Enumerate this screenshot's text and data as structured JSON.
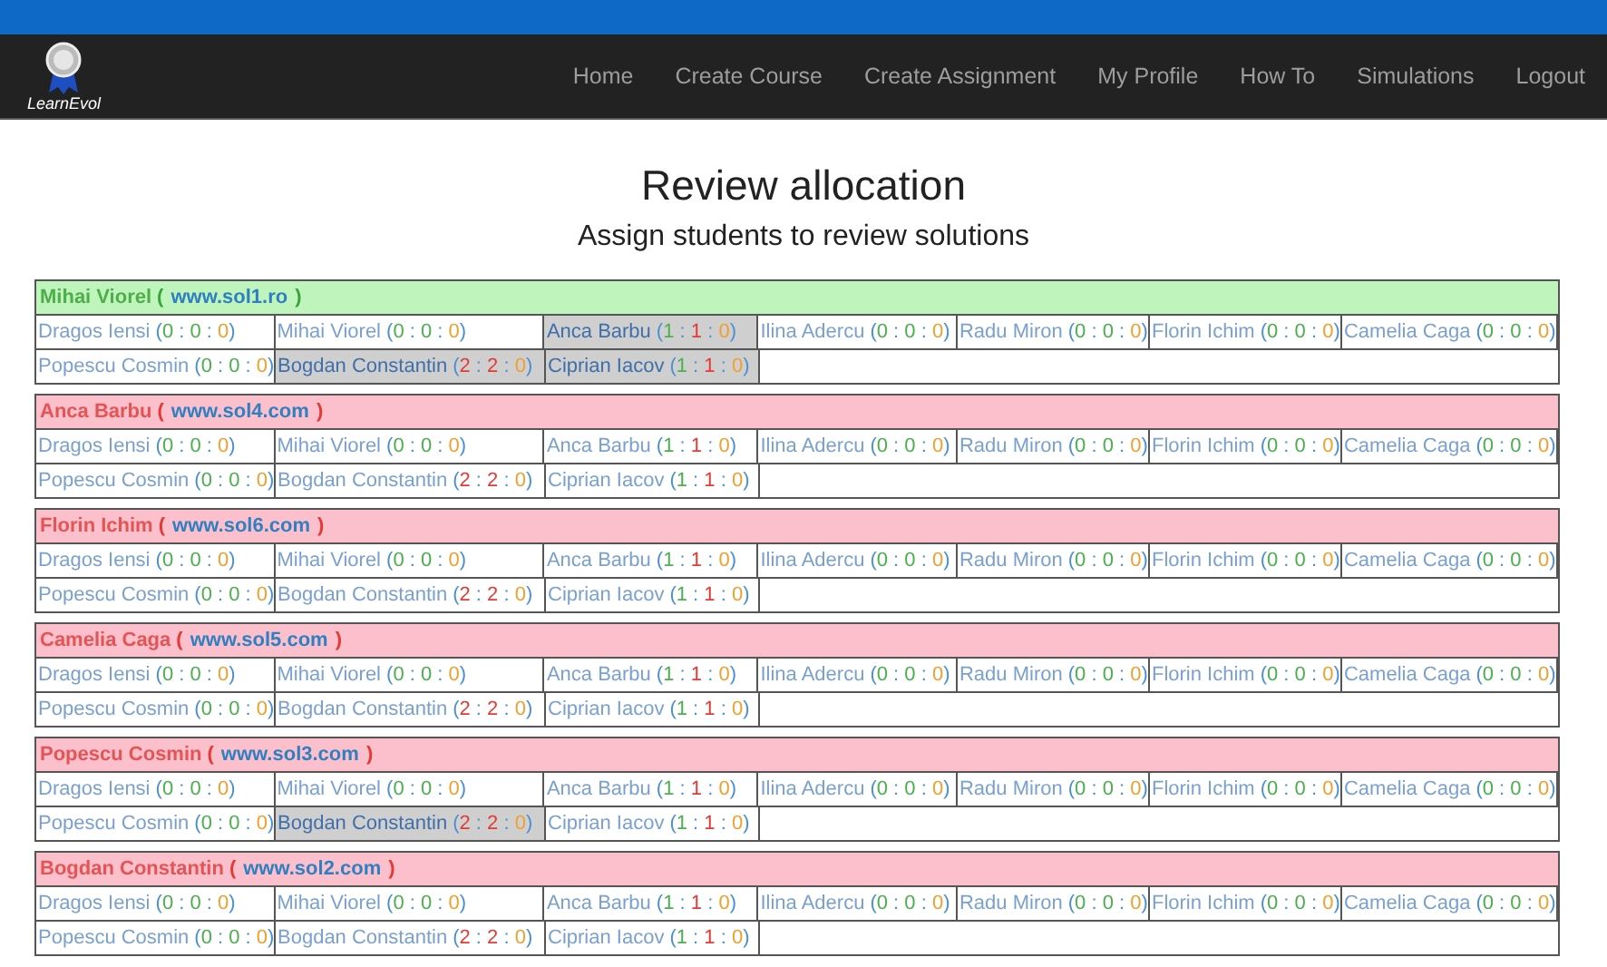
{
  "navbar": {
    "logo_text": "LearnEvol",
    "links": [
      {
        "label": "Home"
      },
      {
        "label": "Create Course"
      },
      {
        "label": "Create Assignment"
      },
      {
        "label": "My Profile"
      },
      {
        "label": "How To"
      },
      {
        "label": "Simulations"
      },
      {
        "label": "Logout"
      }
    ]
  },
  "title": "Review allocation",
  "subtitle": "Assign students to review solutions",
  "submissions": [
    {
      "author": "Mihai Viorel",
      "open": "(",
      "url": "www.sol1.ro",
      "close": ")",
      "kind": "complete",
      "cells": [
        {
          "name": "Dragos Iensi",
          "tally": "(0 : 0 : 0)",
          "counts": [
            {
              "color": "#4caf50"
            },
            {
              "color": "#4caf50"
            },
            {
              "color": "#f0a030"
            }
          ],
          "selected": false
        },
        {
          "name": "Mihai Viorel",
          "tally": "(0 : 0 : 0)",
          "counts": [
            {
              "color": "#4caf50"
            },
            {
              "color": "#4caf50"
            },
            {
              "color": "#f0a030"
            }
          ],
          "selected": false
        },
        {
          "name": "Anca Barbu",
          "tally": "(1 : 1 : 0)",
          "counts": [
            {
              "color": "#4caf50"
            },
            {
              "color": "#e53935"
            },
            {
              "color": "#f0a030"
            }
          ],
          "selected": true
        },
        {
          "name": "Ilina Adercu",
          "tally": "(0 : 0 : 0)",
          "counts": [
            {
              "color": "#4caf50"
            },
            {
              "color": "#4caf50"
            },
            {
              "color": "#f0a030"
            }
          ],
          "selected": false
        },
        {
          "name": "Radu Miron",
          "tally": "(0 : 0 : 0)",
          "counts": [
            {
              "color": "#4caf50"
            },
            {
              "color": "#4caf50"
            },
            {
              "color": "#f0a030"
            }
          ],
          "selected": false
        },
        {
          "name": "Florin Ichim",
          "tally": "(0 : 0 : 0)",
          "counts": [
            {
              "color": "#4caf50"
            },
            {
              "color": "#4caf50"
            },
            {
              "color": "#f0a030"
            }
          ],
          "selected": false
        },
        {
          "name": "Camelia Caga",
          "tally": "(0 : 0 : 0)",
          "counts": [
            {
              "color": "#4caf50"
            },
            {
              "color": "#4caf50"
            },
            {
              "color": "#f0a030"
            }
          ],
          "selected": false
        },
        {
          "name": "Popescu Cosmin",
          "tally": "(0 : 0 : 0)",
          "counts": [
            {
              "color": "#4caf50"
            },
            {
              "color": "#4caf50"
            },
            {
              "color": "#f0a030"
            }
          ],
          "selected": false
        },
        {
          "name": "Bogdan Constantin",
          "tally": "(2 : 2 : 0)",
          "counts": [
            {
              "color": "#e53935"
            },
            {
              "color": "#e53935"
            },
            {
              "color": "#f0a030"
            }
          ],
          "selected": true
        },
        {
          "name": "Ciprian Iacov",
          "tally": "(1 : 1 : 0)",
          "counts": [
            {
              "color": "#4caf50"
            },
            {
              "color": "#e53935"
            },
            {
              "color": "#f0a030"
            }
          ],
          "selected": true
        }
      ]
    },
    {
      "author": "Anca Barbu",
      "open": "(",
      "url": "www.sol4.com",
      "close": ")",
      "kind": "pending",
      "cells": [
        {
          "name": "Dragos Iensi",
          "tally": "(0 : 0 : 0)",
          "counts": [
            {
              "color": "#4caf50"
            },
            {
              "color": "#4caf50"
            },
            {
              "color": "#f0a030"
            }
          ],
          "selected": false
        },
        {
          "name": "Mihai Viorel",
          "tally": "(0 : 0 : 0)",
          "counts": [
            {
              "color": "#4caf50"
            },
            {
              "color": "#4caf50"
            },
            {
              "color": "#f0a030"
            }
          ],
          "selected": false
        },
        {
          "name": "Anca Barbu",
          "tally": "(1 : 1 : 0)",
          "counts": [
            {
              "color": "#4caf50"
            },
            {
              "color": "#e53935"
            },
            {
              "color": "#f0a030"
            }
          ],
          "selected": false
        },
        {
          "name": "Ilina Adercu",
          "tally": "(0 : 0 : 0)",
          "counts": [
            {
              "color": "#4caf50"
            },
            {
              "color": "#4caf50"
            },
            {
              "color": "#f0a030"
            }
          ],
          "selected": false
        },
        {
          "name": "Radu Miron",
          "tally": "(0 : 0 : 0)",
          "counts": [
            {
              "color": "#4caf50"
            },
            {
              "color": "#4caf50"
            },
            {
              "color": "#f0a030"
            }
          ],
          "selected": false
        },
        {
          "name": "Florin Ichim",
          "tally": "(0 : 0 : 0)",
          "counts": [
            {
              "color": "#4caf50"
            },
            {
              "color": "#4caf50"
            },
            {
              "color": "#f0a030"
            }
          ],
          "selected": false
        },
        {
          "name": "Camelia Caga",
          "tally": "(0 : 0 : 0)",
          "counts": [
            {
              "color": "#4caf50"
            },
            {
              "color": "#4caf50"
            },
            {
              "color": "#f0a030"
            }
          ],
          "selected": false
        },
        {
          "name": "Popescu Cosmin",
          "tally": "(0 : 0 : 0)",
          "counts": [
            {
              "color": "#4caf50"
            },
            {
              "color": "#4caf50"
            },
            {
              "color": "#f0a030"
            }
          ],
          "selected": false
        },
        {
          "name": "Bogdan Constantin",
          "tally": "(2 : 2 : 0)",
          "counts": [
            {
              "color": "#e53935"
            },
            {
              "color": "#e53935"
            },
            {
              "color": "#f0a030"
            }
          ],
          "selected": false
        },
        {
          "name": "Ciprian Iacov",
          "tally": "(1 : 1 : 0)",
          "counts": [
            {
              "color": "#4caf50"
            },
            {
              "color": "#e53935"
            },
            {
              "color": "#f0a030"
            }
          ],
          "selected": false
        }
      ]
    },
    {
      "author": "Florin Ichim",
      "open": "(",
      "url": "www.sol6.com",
      "close": ")",
      "kind": "pending",
      "cells": [
        {
          "name": "Dragos Iensi",
          "tally": "(0 : 0 : 0)",
          "counts": [
            {
              "color": "#4caf50"
            },
            {
              "color": "#4caf50"
            },
            {
              "color": "#f0a030"
            }
          ],
          "selected": false
        },
        {
          "name": "Mihai Viorel",
          "tally": "(0 : 0 : 0)",
          "counts": [
            {
              "color": "#4caf50"
            },
            {
              "color": "#4caf50"
            },
            {
              "color": "#f0a030"
            }
          ],
          "selected": false
        },
        {
          "name": "Anca Barbu",
          "tally": "(1 : 1 : 0)",
          "counts": [
            {
              "color": "#4caf50"
            },
            {
              "color": "#e53935"
            },
            {
              "color": "#f0a030"
            }
          ],
          "selected": false
        },
        {
          "name": "Ilina Adercu",
          "tally": "(0 : 0 : 0)",
          "counts": [
            {
              "color": "#4caf50"
            },
            {
              "color": "#4caf50"
            },
            {
              "color": "#f0a030"
            }
          ],
          "selected": false
        },
        {
          "name": "Radu Miron",
          "tally": "(0 : 0 : 0)",
          "counts": [
            {
              "color": "#4caf50"
            },
            {
              "color": "#4caf50"
            },
            {
              "color": "#f0a030"
            }
          ],
          "selected": false
        },
        {
          "name": "Florin Ichim",
          "tally": "(0 : 0 : 0)",
          "counts": [
            {
              "color": "#4caf50"
            },
            {
              "color": "#4caf50"
            },
            {
              "color": "#f0a030"
            }
          ],
          "selected": false
        },
        {
          "name": "Camelia Caga",
          "tally": "(0 : 0 : 0)",
          "counts": [
            {
              "color": "#4caf50"
            },
            {
              "color": "#4caf50"
            },
            {
              "color": "#f0a030"
            }
          ],
          "selected": false
        },
        {
          "name": "Popescu Cosmin",
          "tally": "(0 : 0 : 0)",
          "counts": [
            {
              "color": "#4caf50"
            },
            {
              "color": "#4caf50"
            },
            {
              "color": "#f0a030"
            }
          ],
          "selected": false
        },
        {
          "name": "Bogdan Constantin",
          "tally": "(2 : 2 : 0)",
          "counts": [
            {
              "color": "#e53935"
            },
            {
              "color": "#e53935"
            },
            {
              "color": "#f0a030"
            }
          ],
          "selected": false
        },
        {
          "name": "Ciprian Iacov",
          "tally": "(1 : 1 : 0)",
          "counts": [
            {
              "color": "#4caf50"
            },
            {
              "color": "#e53935"
            },
            {
              "color": "#f0a030"
            }
          ],
          "selected": false
        }
      ]
    },
    {
      "author": "Camelia Caga",
      "open": "(",
      "url": "www.sol5.com",
      "close": ")",
      "kind": "pending",
      "cells": [
        {
          "name": "Dragos Iensi",
          "tally": "(0 : 0 : 0)",
          "counts": [
            {
              "color": "#4caf50"
            },
            {
              "color": "#4caf50"
            },
            {
              "color": "#f0a030"
            }
          ],
          "selected": false
        },
        {
          "name": "Mihai Viorel",
          "tally": "(0 : 0 : 0)",
          "counts": [
            {
              "color": "#4caf50"
            },
            {
              "color": "#4caf50"
            },
            {
              "color": "#f0a030"
            }
          ],
          "selected": false
        },
        {
          "name": "Anca Barbu",
          "tally": "(1 : 1 : 0)",
          "counts": [
            {
              "color": "#4caf50"
            },
            {
              "color": "#e53935"
            },
            {
              "color": "#f0a030"
            }
          ],
          "selected": false
        },
        {
          "name": "Ilina Adercu",
          "tally": "(0 : 0 : 0)",
          "counts": [
            {
              "color": "#4caf50"
            },
            {
              "color": "#4caf50"
            },
            {
              "color": "#f0a030"
            }
          ],
          "selected": false
        },
        {
          "name": "Radu Miron",
          "tally": "(0 : 0 : 0)",
          "counts": [
            {
              "color": "#4caf50"
            },
            {
              "color": "#4caf50"
            },
            {
              "color": "#f0a030"
            }
          ],
          "selected": false
        },
        {
          "name": "Florin Ichim",
          "tally": "(0 : 0 : 0)",
          "counts": [
            {
              "color": "#4caf50"
            },
            {
              "color": "#4caf50"
            },
            {
              "color": "#f0a030"
            }
          ],
          "selected": false
        },
        {
          "name": "Camelia Caga",
          "tally": "(0 : 0 : 0)",
          "counts": [
            {
              "color": "#4caf50"
            },
            {
              "color": "#4caf50"
            },
            {
              "color": "#f0a030"
            }
          ],
          "selected": false
        },
        {
          "name": "Popescu Cosmin",
          "tally": "(0 : 0 : 0)",
          "counts": [
            {
              "color": "#4caf50"
            },
            {
              "color": "#4caf50"
            },
            {
              "color": "#f0a030"
            }
          ],
          "selected": false
        },
        {
          "name": "Bogdan Constantin",
          "tally": "(2 : 2 : 0)",
          "counts": [
            {
              "color": "#e53935"
            },
            {
              "color": "#e53935"
            },
            {
              "color": "#f0a030"
            }
          ],
          "selected": false
        },
        {
          "name": "Ciprian Iacov",
          "tally": "(1 : 1 : 0)",
          "counts": [
            {
              "color": "#4caf50"
            },
            {
              "color": "#e53935"
            },
            {
              "color": "#f0a030"
            }
          ],
          "selected": false
        }
      ]
    },
    {
      "author": "Popescu Cosmin",
      "open": "(",
      "url": "www.sol3.com",
      "close": ")",
      "kind": "pending",
      "cells": [
        {
          "name": "Dragos Iensi",
          "tally": "(0 : 0 : 0)",
          "counts": [
            {
              "color": "#4caf50"
            },
            {
              "color": "#4caf50"
            },
            {
              "color": "#f0a030"
            }
          ],
          "selected": false
        },
        {
          "name": "Mihai Viorel",
          "tally": "(0 : 0 : 0)",
          "counts": [
            {
              "color": "#4caf50"
            },
            {
              "color": "#4caf50"
            },
            {
              "color": "#f0a030"
            }
          ],
          "selected": false
        },
        {
          "name": "Anca Barbu",
          "tally": "(1 : 1 : 0)",
          "counts": [
            {
              "color": "#4caf50"
            },
            {
              "color": "#e53935"
            },
            {
              "color": "#f0a030"
            }
          ],
          "selected": false
        },
        {
          "name": "Ilina Adercu",
          "tally": "(0 : 0 : 0)",
          "counts": [
            {
              "color": "#4caf50"
            },
            {
              "color": "#4caf50"
            },
            {
              "color": "#f0a030"
            }
          ],
          "selected": false
        },
        {
          "name": "Radu Miron",
          "tally": "(0 : 0 : 0)",
          "counts": [
            {
              "color": "#4caf50"
            },
            {
              "color": "#4caf50"
            },
            {
              "color": "#f0a030"
            }
          ],
          "selected": false
        },
        {
          "name": "Florin Ichim",
          "tally": "(0 : 0 : 0)",
          "counts": [
            {
              "color": "#4caf50"
            },
            {
              "color": "#4caf50"
            },
            {
              "color": "#f0a030"
            }
          ],
          "selected": false
        },
        {
          "name": "Camelia Caga",
          "tally": "(0 : 0 : 0)",
          "counts": [
            {
              "color": "#4caf50"
            },
            {
              "color": "#4caf50"
            },
            {
              "color": "#f0a030"
            }
          ],
          "selected": false
        },
        {
          "name": "Popescu Cosmin",
          "tally": "(0 : 0 : 0)",
          "counts": [
            {
              "color": "#4caf50"
            },
            {
              "color": "#4caf50"
            },
            {
              "color": "#f0a030"
            }
          ],
          "selected": false
        },
        {
          "name": "Bogdan Constantin",
          "tally": "(2 : 2 : 0)",
          "counts": [
            {
              "color": "#e53935"
            },
            {
              "color": "#e53935"
            },
            {
              "color": "#f0a030"
            }
          ],
          "selected": true
        },
        {
          "name": "Ciprian Iacov",
          "tally": "(1 : 1 : 0)",
          "counts": [
            {
              "color": "#4caf50"
            },
            {
              "color": "#e53935"
            },
            {
              "color": "#f0a030"
            }
          ],
          "selected": false
        }
      ]
    },
    {
      "author": "Bogdan Constantin",
      "open": "(",
      "url": "www.sol2.com",
      "close": ")",
      "kind": "pending",
      "cells": [
        {
          "name": "Dragos Iensi",
          "tally": "(0 : 0 : 0)",
          "counts": [
            {
              "color": "#4caf50"
            },
            {
              "color": "#4caf50"
            },
            {
              "color": "#f0a030"
            }
          ],
          "selected": false
        },
        {
          "name": "Mihai Viorel",
          "tally": "(0 : 0 : 0)",
          "counts": [
            {
              "color": "#4caf50"
            },
            {
              "color": "#4caf50"
            },
            {
              "color": "#f0a030"
            }
          ],
          "selected": false
        },
        {
          "name": "Anca Barbu",
          "tally": "(1 : 1 : 0)",
          "counts": [
            {
              "color": "#4caf50"
            },
            {
              "color": "#e53935"
            },
            {
              "color": "#f0a030"
            }
          ],
          "selected": false
        },
        {
          "name": "Ilina Adercu",
          "tally": "(0 : 0 : 0)",
          "counts": [
            {
              "color": "#4caf50"
            },
            {
              "color": "#4caf50"
            },
            {
              "color": "#f0a030"
            }
          ],
          "selected": false
        },
        {
          "name": "Radu Miron",
          "tally": "(0 : 0 : 0)",
          "counts": [
            {
              "color": "#4caf50"
            },
            {
              "color": "#4caf50"
            },
            {
              "color": "#f0a030"
            }
          ],
          "selected": false
        },
        {
          "name": "Florin Ichim",
          "tally": "(0 : 0 : 0)",
          "counts": [
            {
              "color": "#4caf50"
            },
            {
              "color": "#4caf50"
            },
            {
              "color": "#f0a030"
            }
          ],
          "selected": false
        },
        {
          "name": "Camelia Caga",
          "tally": "(0 : 0 : 0)",
          "counts": [
            {
              "color": "#4caf50"
            },
            {
              "color": "#4caf50"
            },
            {
              "color": "#f0a030"
            }
          ],
          "selected": false
        },
        {
          "name": "Popescu Cosmin",
          "tally": "(0 : 0 : 0)",
          "counts": [
            {
              "color": "#4caf50"
            },
            {
              "color": "#4caf50"
            },
            {
              "color": "#f0a030"
            }
          ],
          "selected": false
        },
        {
          "name": "Bogdan Constantin",
          "tally": "(2 : 2 : 0)",
          "counts": [
            {
              "color": "#e53935"
            },
            {
              "color": "#e53935"
            },
            {
              "color": "#f0a030"
            }
          ],
          "selected": false
        },
        {
          "name": "Ciprian Iacov",
          "tally": "(1 : 1 : 0)",
          "counts": [
            {
              "color": "#4caf50"
            },
            {
              "color": "#e53935"
            },
            {
              "color": "#f0a030"
            }
          ],
          "selected": false
        }
      ]
    }
  ]
}
